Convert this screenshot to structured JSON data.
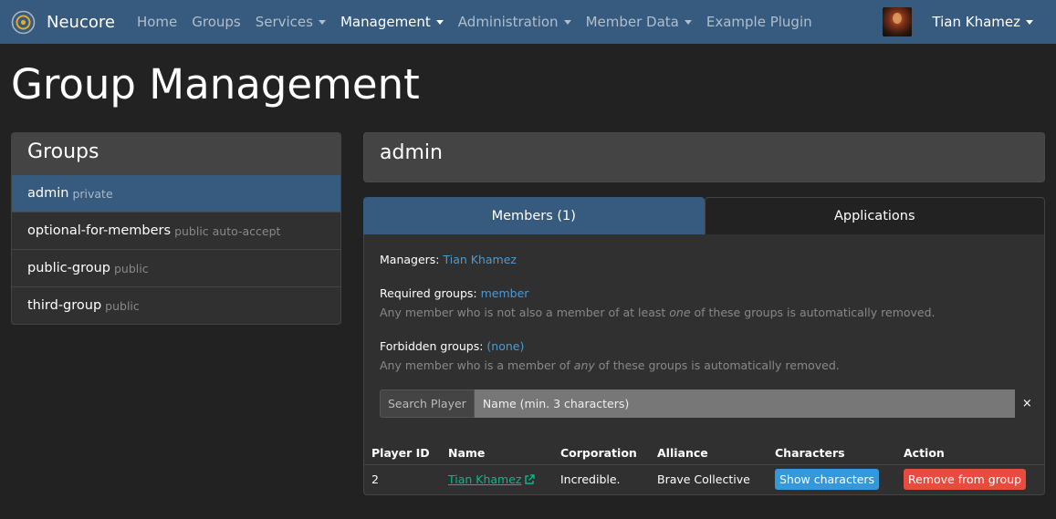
{
  "navbar": {
    "brand": "Neucore",
    "items": [
      {
        "label": "Home",
        "dropdown": false,
        "active": false
      },
      {
        "label": "Groups",
        "dropdown": false,
        "active": false
      },
      {
        "label": "Services",
        "dropdown": true,
        "active": false
      },
      {
        "label": "Management",
        "dropdown": true,
        "active": true
      },
      {
        "label": "Administration",
        "dropdown": true,
        "active": false
      },
      {
        "label": "Member Data",
        "dropdown": true,
        "active": false
      },
      {
        "label": "Example Plugin",
        "dropdown": false,
        "active": false
      }
    ],
    "user_name": "Tian Khamez"
  },
  "page": {
    "title": "Group Management"
  },
  "groups": {
    "header": "Groups",
    "items": [
      {
        "name": "admin",
        "tag": "private",
        "active": true
      },
      {
        "name": "optional-for-members",
        "tag": "public auto-accept",
        "active": false
      },
      {
        "name": "public-group",
        "tag": "public",
        "active": false
      },
      {
        "name": "third-group",
        "tag": "public",
        "active": false
      }
    ]
  },
  "selected_group": {
    "name": "admin"
  },
  "tabs": {
    "members": "Members (1)",
    "applications": "Applications"
  },
  "details": {
    "managers_label": "Managers:",
    "managers_value": "Tian Khamez",
    "required_label": "Required groups:",
    "required_value": "member",
    "required_note_pre": "Any member who is not also a member of at least ",
    "required_note_em": "one",
    "required_note_post": " of these groups is automatically removed.",
    "forbidden_label": "Forbidden groups:",
    "forbidden_value": "(none)",
    "forbidden_note_pre": "Any member who is a member of ",
    "forbidden_note_em": "any",
    "forbidden_note_post": " of these groups is automatically removed."
  },
  "search": {
    "label": "Search Player",
    "placeholder": "Name (min. 3 characters)",
    "clear": "×"
  },
  "table": {
    "headers": [
      "Player ID",
      "Name",
      "Corporation",
      "Alliance",
      "Characters",
      "Action"
    ],
    "rows": [
      {
        "id": "2",
        "name": "Tian Khamez",
        "corporation": "Incredible.",
        "alliance": "Brave Collective",
        "characters_button": "Show characters",
        "action_button": "Remove from group"
      }
    ]
  },
  "colors": {
    "navbar": "#375a7f",
    "background": "#222222",
    "link": "#4a9bd6",
    "success_link": "#00bc8c",
    "info_button": "#3498db",
    "danger_button": "#e74c3c"
  }
}
